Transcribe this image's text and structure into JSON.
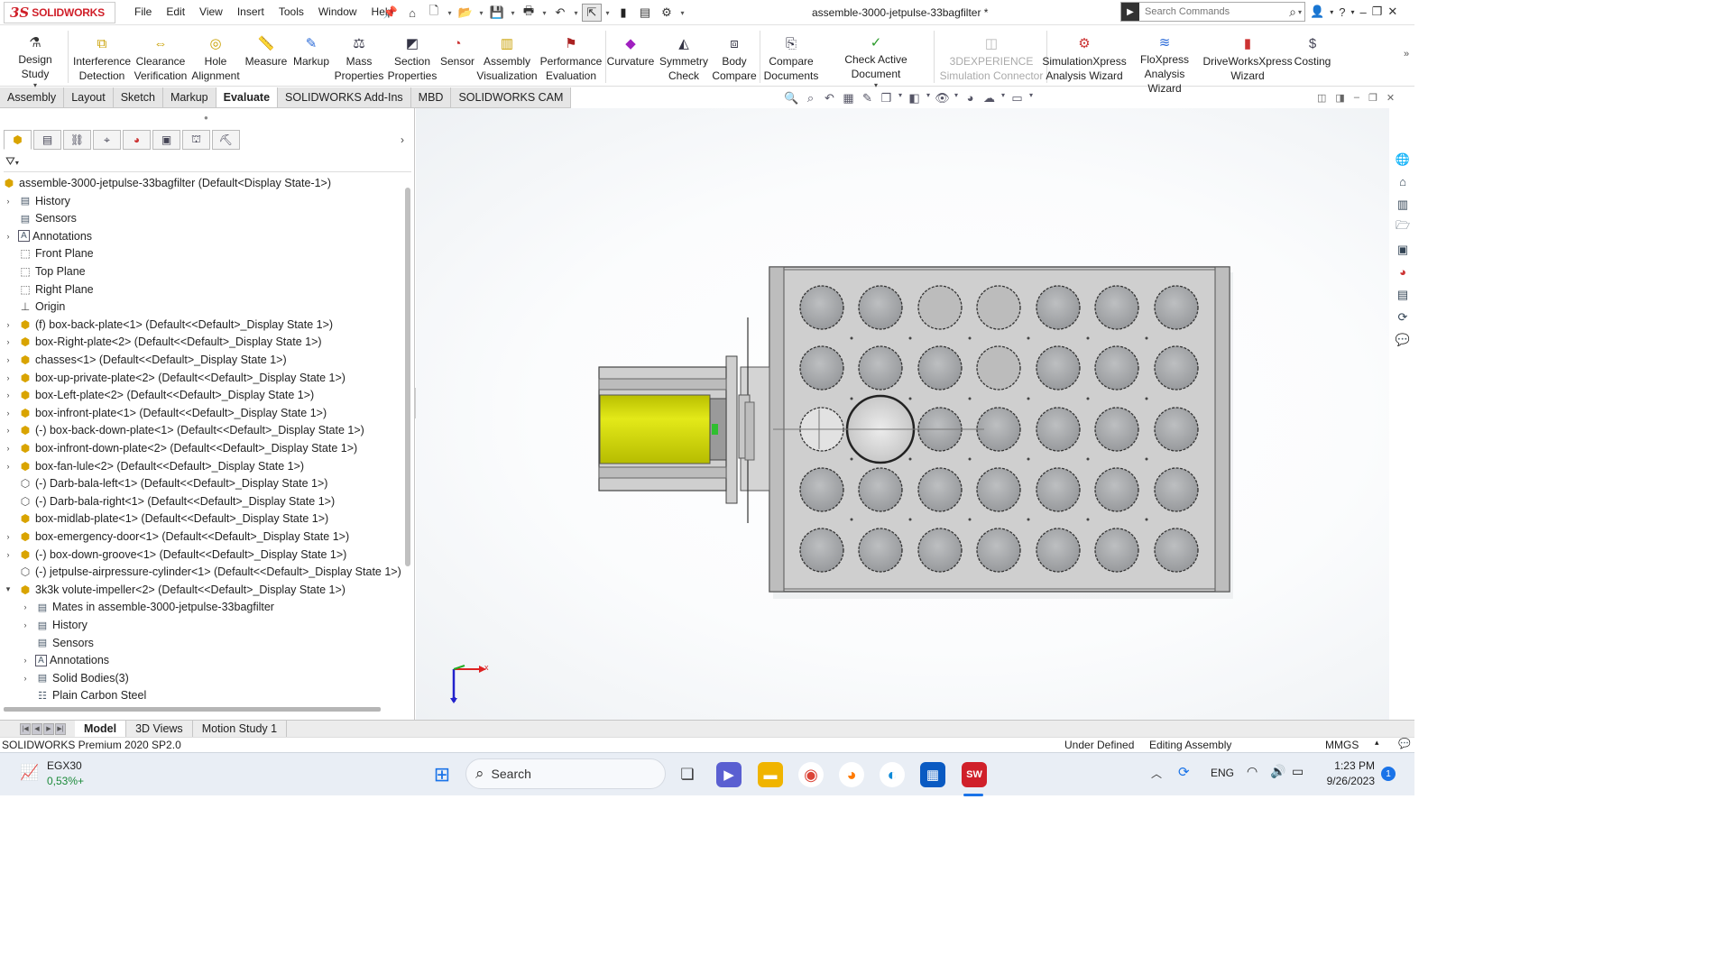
{
  "app": {
    "logo_ds": "3S",
    "logo_text": "SOLIDWORKS",
    "menu": [
      "File",
      "Edit",
      "View",
      "Insert",
      "Tools",
      "Window",
      "Help"
    ],
    "document_title": "assemble-3000-jetpulse-33bagfilter *",
    "search_placeholder": "Search Commands"
  },
  "ribbon": [
    {
      "label": "Design Study",
      "icon": "design-study-icon",
      "dropdown": true
    },
    {
      "label": "Interference\nDetection",
      "icon": "interference-icon"
    },
    {
      "label": "Clearance\nVerification",
      "icon": "clearance-icon"
    },
    {
      "label": "Hole\nAlignment",
      "icon": "hole-alignment-icon"
    },
    {
      "label": "Measure",
      "icon": "measure-icon"
    },
    {
      "label": "Markup",
      "icon": "markup-icon"
    },
    {
      "label": "Mass\nProperties",
      "icon": "mass-properties-icon"
    },
    {
      "label": "Section\nProperties",
      "icon": "section-properties-icon"
    },
    {
      "label": "Sensor",
      "icon": "sensor-icon"
    },
    {
      "label": "Assembly\nVisualization",
      "icon": "assembly-visualization-icon"
    },
    {
      "label": "Performance\nEvaluation",
      "icon": "performance-icon"
    },
    {
      "label": "Curvature",
      "icon": "curvature-icon"
    },
    {
      "label": "Symmetry\nCheck",
      "icon": "symmetry-icon"
    },
    {
      "label": "Body\nCompare",
      "icon": "body-compare-icon"
    },
    {
      "label": "Compare\nDocuments",
      "icon": "compare-documents-icon"
    },
    {
      "label": "Check Active Document",
      "icon": "check-document-icon",
      "dropdown": true
    },
    {
      "label": "3DEXPERIENCE\nSimulation Connector",
      "icon": "3dexperience-icon",
      "disabled": true
    },
    {
      "label": "SimulationXpress\nAnalysis Wizard",
      "icon": "simulationxpress-icon"
    },
    {
      "label": "FloXpress\nAnalysis Wizard",
      "icon": "floxpress-icon"
    },
    {
      "label": "DriveWorksXpress\nWizard",
      "icon": "driveworks-icon"
    },
    {
      "label": "Costing",
      "icon": "costing-icon"
    }
  ],
  "command_tabs": [
    "Assembly",
    "Layout",
    "Sketch",
    "Markup",
    "Evaluate",
    "SOLIDWORKS Add-Ins",
    "MBD",
    "SOLIDWORKS CAM"
  ],
  "active_command_tab": "Evaluate",
  "tree": {
    "root": "assemble-3000-jetpulse-33bagfilter  (Default<Display State-1>)",
    "items": [
      {
        "label": "History",
        "type": "folder",
        "expand": true,
        "indent": 0
      },
      {
        "label": "Sensors",
        "type": "folder",
        "expand": false,
        "indent": 0
      },
      {
        "label": "Annotations",
        "type": "annotation",
        "expand": true,
        "indent": 0
      },
      {
        "label": "Front Plane",
        "type": "plane",
        "expand": false,
        "indent": 0
      },
      {
        "label": "Top Plane",
        "type": "plane",
        "expand": false,
        "indent": 0
      },
      {
        "label": "Right Plane",
        "type": "plane",
        "expand": false,
        "indent": 0
      },
      {
        "label": "Origin",
        "type": "origin",
        "expand": false,
        "indent": 0
      },
      {
        "label": "(f) box-back-plate<1> (Default<<Default>_Display State 1>)",
        "type": "part",
        "expand": true,
        "indent": 0
      },
      {
        "label": "box-Right-plate<2> (Default<<Default>_Display State 1>)",
        "type": "part",
        "expand": true,
        "indent": 0
      },
      {
        "label": "chasses<1> (Default<<Default>_Display State 1>)",
        "type": "part",
        "expand": true,
        "indent": 0
      },
      {
        "label": "box-up-private-plate<2> (Default<<Default>_Display State 1>)",
        "type": "part",
        "expand": true,
        "indent": 0
      },
      {
        "label": "box-Left-plate<2> (Default<<Default>_Display State 1>)",
        "type": "part",
        "expand": true,
        "indent": 0
      },
      {
        "label": "box-infront-plate<1> (Default<<Default>_Display State 1>)",
        "type": "part",
        "expand": true,
        "indent": 0
      },
      {
        "label": "(-) box-back-down-plate<1> (Default<<Default>_Display State 1>)",
        "type": "part",
        "expand": true,
        "indent": 0
      },
      {
        "label": "box-infront-down-plate<2> (Default<<Default>_Display State 1>)",
        "type": "part",
        "expand": true,
        "indent": 0
      },
      {
        "label": "box-fan-lule<2> (Default<<Default>_Display State 1>)",
        "type": "part",
        "expand": true,
        "indent": 0
      },
      {
        "label": "(-) Darb-bala-left<1> (Default<<Default>_Display State 1>)",
        "type": "partwire",
        "expand": false,
        "indent": 0
      },
      {
        "label": "(-) Darb-bala-right<1> (Default<<Default>_Display State 1>)",
        "type": "partwire",
        "expand": false,
        "indent": 0
      },
      {
        "label": "box-midlab-plate<1> (Default<<Default>_Display State 1>)",
        "type": "part",
        "expand": false,
        "indent": 0
      },
      {
        "label": "box-emergency-door<1> (Default<<Default>_Display State 1>)",
        "type": "part",
        "expand": true,
        "indent": 0
      },
      {
        "label": "(-) box-down-groove<1> (Default<<Default>_Display State 1>)",
        "type": "part",
        "expand": true,
        "indent": 0
      },
      {
        "label": "(-) jetpulse-airpressure-cylinder<1> (Default<<Default>_Display State 1>)",
        "type": "partwire",
        "expand": false,
        "indent": 0
      },
      {
        "label": "3k3k volute-impeller<2> (Default<<Default>_Display State 1>)",
        "type": "part",
        "expand": "open",
        "indent": 0
      },
      {
        "label": "Mates in assemble-3000-jetpulse-33bagfilter",
        "type": "folder",
        "expand": true,
        "indent": 1
      },
      {
        "label": "History",
        "type": "folder",
        "expand": true,
        "indent": 1
      },
      {
        "label": "Sensors",
        "type": "folder",
        "expand": false,
        "indent": 1
      },
      {
        "label": "Annotations",
        "type": "annotation",
        "expand": true,
        "indent": 1
      },
      {
        "label": "Solid Bodies(3)",
        "type": "folder",
        "expand": true,
        "indent": 1
      },
      {
        "label": "Plain Carbon Steel",
        "type": "material",
        "expand": false,
        "indent": 1
      }
    ]
  },
  "bottom_tabs": [
    "Model",
    "3D Views",
    "Motion Study 1"
  ],
  "active_bottom_tab": "Model",
  "status": {
    "version": "SOLIDWORKS Premium 2020 SP2.0",
    "definition": "Under Defined",
    "mode": "Editing Assembly",
    "units": "MMGS"
  },
  "triad": {
    "x": "x",
    "z": "z"
  },
  "taskbar": {
    "stock_name": "EGX30",
    "stock_change": "0,53%+",
    "search_label": "Search",
    "language": "ENG",
    "time": "1:23 PM",
    "date": "9/26/2023",
    "notification_count": "1"
  },
  "colors": {
    "accent_red": "#d0202a",
    "motor_yellow": "#d7dd0f",
    "plate_gray": "#cfcfcf",
    "hole_gray": "#a9abad"
  }
}
